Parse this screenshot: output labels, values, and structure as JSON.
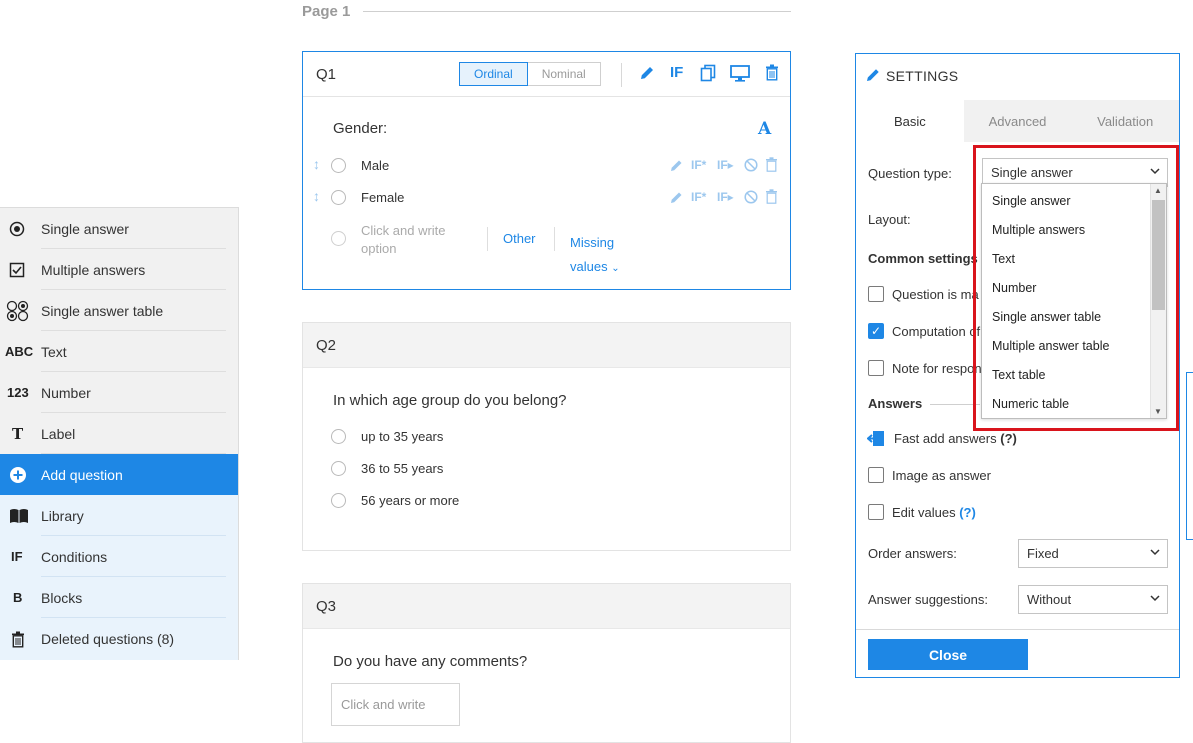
{
  "page": {
    "title": "Page 1"
  },
  "sidebar": {
    "items": [
      {
        "label": "Single answer",
        "icon": "radio-icon"
      },
      {
        "label": "Multiple answers",
        "icon": "checkbox-icon"
      },
      {
        "label": "Single answer table",
        "icon": "table-radios-icon"
      },
      {
        "label": "Text",
        "icon": "ABC"
      },
      {
        "label": "Number",
        "icon": "123"
      },
      {
        "label": "Label",
        "icon": "T"
      },
      {
        "label": "Add question",
        "icon": "plus-circle-icon"
      },
      {
        "label": "Library",
        "icon": "book-icon"
      },
      {
        "label": "Conditions",
        "icon": "IF"
      },
      {
        "label": "Blocks",
        "icon": "B"
      },
      {
        "label": "Deleted questions (8)",
        "icon": "trash-icon"
      }
    ]
  },
  "q1": {
    "id": "Q1",
    "toggle": [
      "Ordinal",
      "Nominal"
    ],
    "question": "Gender:",
    "options": [
      "Male",
      "Female"
    ],
    "add_option_placeholder": [
      "Click and write",
      "option"
    ],
    "other_label": "Other",
    "missing_label": [
      "Missing",
      "values"
    ],
    "if_label": "IF",
    "if_star": "IF*",
    "if_arrow": "IF",
    "font_icon": "A"
  },
  "q2": {
    "id": "Q2",
    "question": "In which age group do you belong?",
    "options": [
      "up to 35 years",
      "36 to 55 years",
      "56 years or more"
    ]
  },
  "q3": {
    "id": "Q3",
    "question": "Do you have any comments?",
    "placeholder": "Click and write"
  },
  "settings": {
    "title": "SETTINGS",
    "tabs": [
      "Basic",
      "Advanced",
      "Validation"
    ],
    "question_type_label": "Question type:",
    "question_type_value": "Single answer",
    "layout_label": "Layout:",
    "common_label": "Common settings",
    "checks": [
      {
        "label": "Question is ma",
        "checked": false
      },
      {
        "label": "Computation of",
        "checked": true
      },
      {
        "label": "Note for respon",
        "checked": false
      }
    ],
    "answers_label": "Answers",
    "fast_add": "Fast add answers",
    "help": "(?)",
    "image_as_answer": "Image as answer",
    "edit_values": "Edit values",
    "order_label": "Order answers:",
    "order_value": "Fixed",
    "suggest_label": "Answer suggestions:",
    "suggest_value": "Without",
    "close": "Close"
  },
  "dropdown": {
    "options": [
      "Single answer",
      "Multiple answers",
      "Text",
      "Number",
      "Single answer table",
      "Multiple answer table",
      "Text table",
      "Numeric table"
    ]
  },
  "colors": {
    "accent": "#1e87e5",
    "highlight": "#d9141c"
  }
}
